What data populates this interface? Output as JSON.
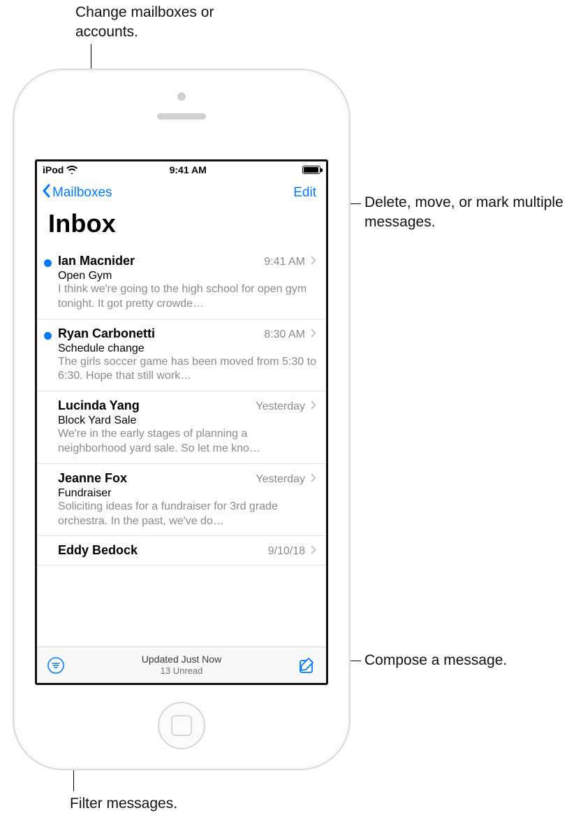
{
  "status": {
    "carrier": "iPod",
    "time": "9:41 AM"
  },
  "nav": {
    "back_label": "Mailboxes",
    "edit_label": "Edit"
  },
  "title": "Inbox",
  "toolbar": {
    "updated": "Updated Just Now",
    "unread": "13 Unread"
  },
  "messages": [
    {
      "unread": true,
      "sender": "Ian Macnider",
      "time": "9:41 AM",
      "subject": "Open Gym",
      "preview": "I think we're going to the high school for open gym tonight. It got pretty crowde…"
    },
    {
      "unread": true,
      "sender": "Ryan Carbonetti",
      "time": "8:30 AM",
      "subject": "Schedule change",
      "preview": "The girls soccer game has been moved from 5:30 to 6:30. Hope that still work…"
    },
    {
      "unread": false,
      "sender": "Lucinda Yang",
      "time": "Yesterday",
      "subject": "Block Yard Sale",
      "preview": "We're in the early stages of planning a neighborhood yard sale. So let me kno…"
    },
    {
      "unread": false,
      "sender": "Jeanne Fox",
      "time": "Yesterday",
      "subject": "Fundraiser",
      "preview": "Soliciting ideas for a fundraiser for 3rd grade orchestra. In the past, we've do…"
    },
    {
      "unread": false,
      "sender": "Eddy Bedock",
      "time": "9/10/18",
      "subject": "",
      "preview": ""
    }
  ],
  "callouts": {
    "mailboxes": "Change mailboxes or accounts.",
    "edit": "Delete, move, or mark multiple messages.",
    "compose": "Compose a message.",
    "filter": "Filter messages."
  }
}
